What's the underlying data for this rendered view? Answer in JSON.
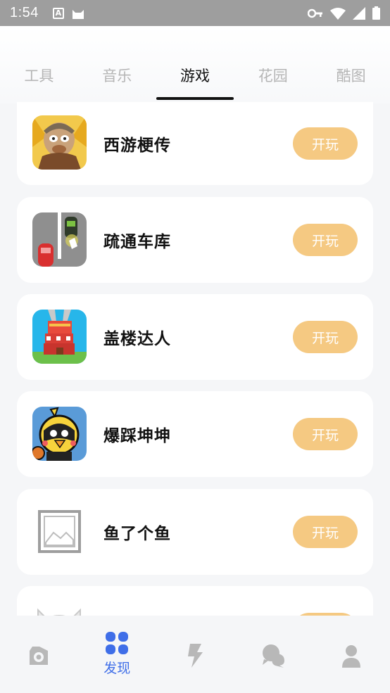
{
  "status_bar": {
    "time": "1:54",
    "icons": [
      "a-notification-icon",
      "cat-icon",
      "key-icon",
      "wifi-icon",
      "signal-icon",
      "battery-icon"
    ]
  },
  "tabs": [
    {
      "label": "工具",
      "active": false
    },
    {
      "label": "音乐",
      "active": false
    },
    {
      "label": "游戏",
      "active": true
    },
    {
      "label": "花园",
      "active": false
    },
    {
      "label": "酷图",
      "active": false
    }
  ],
  "games": [
    {
      "name": "西游梗传",
      "button": "开玩",
      "icon": "monkey-king-icon"
    },
    {
      "name": "疏通车库",
      "button": "开玩",
      "icon": "parking-cars-icon"
    },
    {
      "name": "盖楼达人",
      "button": "开玩",
      "icon": "tower-crane-icon"
    },
    {
      "name": "爆踩坤坤",
      "button": "开玩",
      "icon": "chicken-character-icon"
    },
    {
      "name": "鱼了个鱼",
      "button": "开玩",
      "icon": "image-placeholder-icon"
    },
    {
      "name": "",
      "button": "",
      "icon": "cat-avatar-icon"
    }
  ],
  "bottom_nav": [
    {
      "label": "",
      "icon": "camera-icon",
      "active": false
    },
    {
      "label": "发现",
      "icon": "discover-grid-icon",
      "active": true
    },
    {
      "label": "",
      "icon": "lightning-icon",
      "active": false
    },
    {
      "label": "",
      "icon": "chat-icon",
      "active": false
    },
    {
      "label": "",
      "icon": "profile-icon",
      "active": false
    }
  ],
  "colors": {
    "accent": "#3f6ee8",
    "play_button": "#f5c982",
    "inactive_tab": "#b5b5b5",
    "inactive_nav": "#b8b8b8"
  }
}
